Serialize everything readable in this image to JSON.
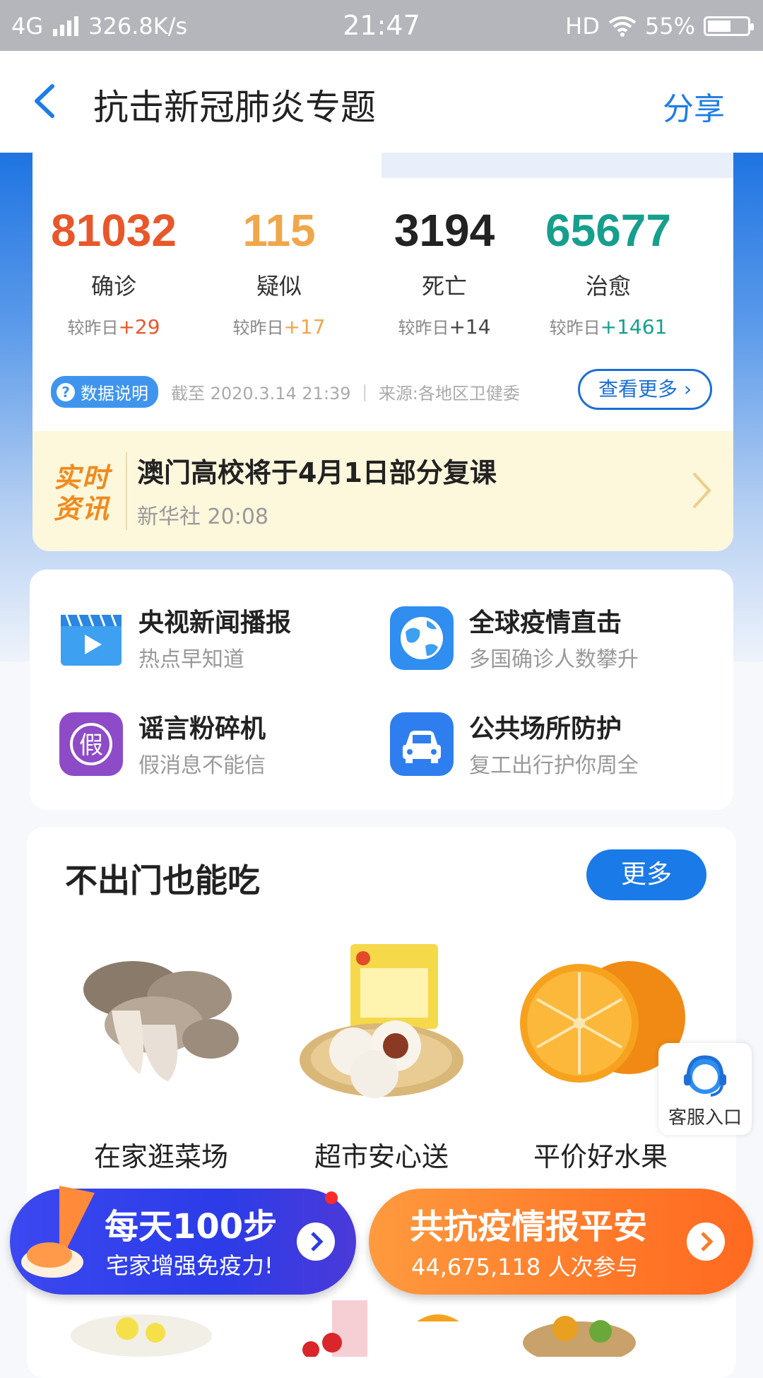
{
  "status_bar": {
    "network": "4G",
    "speed": "326.8K/s",
    "time": "21:47",
    "hd": "HD",
    "battery": "55%"
  },
  "header": {
    "title": "抗击新冠肺炎专题",
    "share": "分享"
  },
  "stats": [
    {
      "value": "81032",
      "label": "确诊",
      "change_prefix": "较昨日",
      "change": "+29",
      "color": "#e8572a"
    },
    {
      "value": "115",
      "label": "疑似",
      "change_prefix": "较昨日",
      "change": "+17",
      "color": "#f0a64a"
    },
    {
      "value": "3194",
      "label": "死亡",
      "change_prefix": "较昨日",
      "change": "+14",
      "color": "#222222"
    },
    {
      "value": "65677",
      "label": "治愈",
      "change_prefix": "较昨日",
      "change": "+1461",
      "color": "#169f8c"
    }
  ],
  "data_note": {
    "pill": "数据说明",
    "source": "截至 2020.3.14 21:39 ｜ 来源:各地区卫健委",
    "more": "查看更多 ›"
  },
  "news": {
    "logo_line1": "实时",
    "logo_line2": "资讯",
    "title": "澳门高校将于4月1日部分复课",
    "meta": "新华社 20:08"
  },
  "services": [
    {
      "title": "央视新闻播报",
      "subtitle": "热点早知道",
      "icon": "video-play-icon"
    },
    {
      "title": "全球疫情直击",
      "subtitle": "多国确诊人数攀升",
      "icon": "globe-icon"
    },
    {
      "title": "谣言粉碎机",
      "subtitle": "假消息不能信",
      "icon": "fake-badge-icon"
    },
    {
      "title": "公共场所防护",
      "subtitle": "复工出行护你周全",
      "icon": "car-icon"
    }
  ],
  "food_section": {
    "title": "不出门也能吃",
    "more": "更多",
    "items": [
      {
        "label": "在家逛菜场",
        "icon": "mushroom-image"
      },
      {
        "label": "超市安心送",
        "icon": "bun-image"
      },
      {
        "label": "平价好水果",
        "icon": "orange-image"
      }
    ]
  },
  "customer_service": {
    "label": "客服入口",
    "icon": "headset-icon"
  },
  "banners": [
    {
      "title": "每天100步",
      "subtitle": "宅家增强免疫力!"
    },
    {
      "title": "共抗疫情报平安",
      "subtitle": "44,675,118 人次参与"
    }
  ]
}
